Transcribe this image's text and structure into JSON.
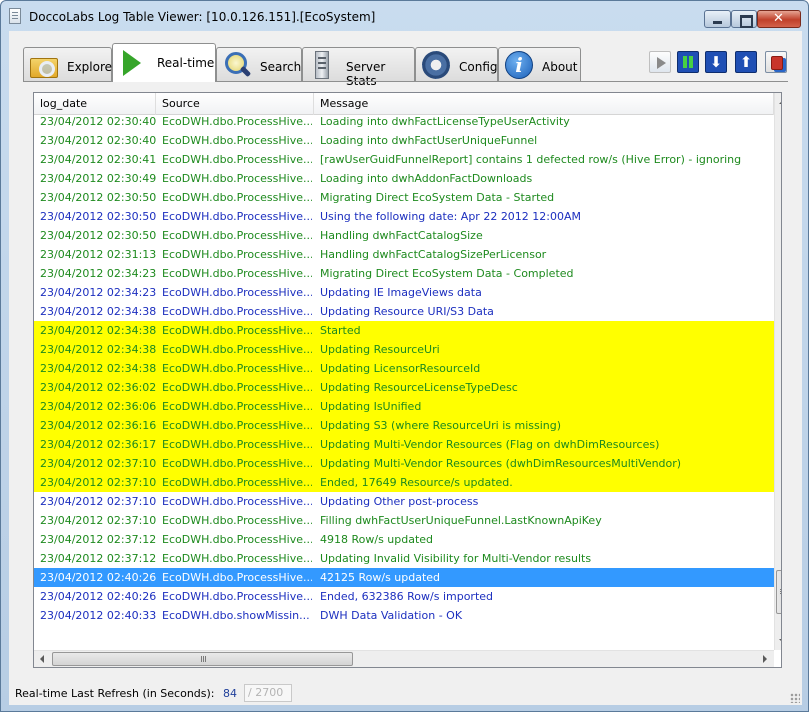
{
  "window": {
    "title": "DoccoLabs Log Table Viewer: [10.0.126.151].[EcoSystem]"
  },
  "tabs": [
    {
      "label": "Explore",
      "icon": "folder-search-icon"
    },
    {
      "label": "Real-time",
      "icon": "play-icon",
      "active": true
    },
    {
      "label": "Search",
      "icon": "magnifier-icon"
    },
    {
      "label": "Server Stats",
      "icon": "server-icon"
    },
    {
      "label": "Config",
      "icon": "gear-icon"
    },
    {
      "label": "About",
      "icon": "info-icon"
    }
  ],
  "toolbar": [
    "play-icon",
    "pause-icon",
    "scroll-down-icon",
    "scroll-up-icon",
    "export-icon"
  ],
  "grid": {
    "columns": [
      "log_date",
      "Source",
      "Message"
    ],
    "colors": {
      "green": "#1e8a1e",
      "blue": "#1c2fbf",
      "highlight": "#ffff00",
      "selection": "#3399ff"
    },
    "rows": [
      {
        "date": "23/04/2012 02:30:40",
        "source": "EcoDWH.dbo.ProcessHive...",
        "message": "Loading into dwhFactLicenseTypeUserActivity",
        "color": "green"
      },
      {
        "date": "23/04/2012 02:30:40",
        "source": "EcoDWH.dbo.ProcessHive...",
        "message": "Loading into dwhFactUserUniqueFunnel",
        "color": "green"
      },
      {
        "date": "23/04/2012 02:30:41",
        "source": "EcoDWH.dbo.ProcessHive...",
        "message": "[rawUserGuidFunnelReport] contains 1 defected row/s (Hive Error) - ignoring",
        "color": "green"
      },
      {
        "date": "23/04/2012 02:30:49",
        "source": "EcoDWH.dbo.ProcessHive...",
        "message": "Loading into dwhAddonFactDownloads",
        "color": "green"
      },
      {
        "date": "23/04/2012 02:30:50",
        "source": "EcoDWH.dbo.ProcessHive...",
        "message": "Migrating Direct EcoSystem Data - Started",
        "color": "green"
      },
      {
        "date": "23/04/2012 02:30:50",
        "source": "EcoDWH.dbo.ProcessHive...",
        "message": "Using the following date: Apr 22 2012 12:00AM",
        "color": "blue"
      },
      {
        "date": "23/04/2012 02:30:50",
        "source": "EcoDWH.dbo.ProcessHive...",
        "message": "Handling dwhFactCatalogSize",
        "color": "green"
      },
      {
        "date": "23/04/2012 02:31:13",
        "source": "EcoDWH.dbo.ProcessHive...",
        "message": "Handling dwhFactCatalogSizePerLicensor",
        "color": "green"
      },
      {
        "date": "23/04/2012 02:34:23",
        "source": "EcoDWH.dbo.ProcessHive...",
        "message": "Migrating Direct EcoSystem Data - Completed",
        "color": "green"
      },
      {
        "date": "23/04/2012 02:34:23",
        "source": "EcoDWH.dbo.ProcessHive...",
        "message": "Updating IE ImageViews data",
        "color": "blue"
      },
      {
        "date": "23/04/2012 02:34:38",
        "source": "EcoDWH.dbo.ProcessHive...",
        "message": "Updating Resource URI/S3 Data",
        "color": "blue"
      },
      {
        "date": "23/04/2012 02:34:38",
        "source": "EcoDWH.dbo.ProcessHive...",
        "message": "Started",
        "color": "green",
        "highlight": true
      },
      {
        "date": "23/04/2012 02:34:38",
        "source": "EcoDWH.dbo.ProcessHive...",
        "message": "Updating ResourceUri",
        "color": "green",
        "highlight": true
      },
      {
        "date": "23/04/2012 02:34:38",
        "source": "EcoDWH.dbo.ProcessHive...",
        "message": "Updating LicensorResourceId",
        "color": "green",
        "highlight": true
      },
      {
        "date": "23/04/2012 02:36:02",
        "source": "EcoDWH.dbo.ProcessHive...",
        "message": "Updating ResourceLicenseTypeDesc",
        "color": "green",
        "highlight": true
      },
      {
        "date": "23/04/2012 02:36:06",
        "source": "EcoDWH.dbo.ProcessHive...",
        "message": "Updating IsUnified",
        "color": "green",
        "highlight": true
      },
      {
        "date": "23/04/2012 02:36:16",
        "source": "EcoDWH.dbo.ProcessHive...",
        "message": "Updating S3 (where ResourceUri is missing)",
        "color": "green",
        "highlight": true
      },
      {
        "date": "23/04/2012 02:36:17",
        "source": "EcoDWH.dbo.ProcessHive...",
        "message": "Updating Multi-Vendor Resources (Flag on dwhDimResources)",
        "color": "green",
        "highlight": true
      },
      {
        "date": "23/04/2012 02:37:10",
        "source": "EcoDWH.dbo.ProcessHive...",
        "message": "Updating Multi-Vendor Resources (dwhDimResourcesMultiVendor)",
        "color": "green",
        "highlight": true
      },
      {
        "date": "23/04/2012 02:37:10",
        "source": "EcoDWH.dbo.ProcessHive...",
        "message": "Ended, 17649 Resource/s updated.",
        "color": "green",
        "highlight": true
      },
      {
        "date": "23/04/2012 02:37:10",
        "source": "EcoDWH.dbo.ProcessHive...",
        "message": "Updating Other post-process",
        "color": "blue"
      },
      {
        "date": "23/04/2012 02:37:10",
        "source": "EcoDWH.dbo.ProcessHive...",
        "message": "Filling dwhFactUserUniqueFunnel.LastKnownApiKey",
        "color": "green"
      },
      {
        "date": "23/04/2012 02:37:12",
        "source": "EcoDWH.dbo.ProcessHive...",
        "message": "4918 Row/s updated",
        "color": "green"
      },
      {
        "date": "23/04/2012 02:37:12",
        "source": "EcoDWH.dbo.ProcessHive...",
        "message": "Updating Invalid Visibility for Multi-Vendor results",
        "color": "green"
      },
      {
        "date": "23/04/2012 02:40:26",
        "source": "EcoDWH.dbo.ProcessHive...",
        "message": "42125 Row/s updated",
        "color": "green",
        "selected": true
      },
      {
        "date": "23/04/2012 02:40:26",
        "source": "EcoDWH.dbo.ProcessHive...",
        "message": "Ended, 632386 Row/s imported",
        "color": "blue"
      },
      {
        "date": "23/04/2012 02:40:33",
        "source": "EcoDWH.dbo.showMissin...",
        "message": "DWH Data Validation - OK",
        "color": "blue"
      }
    ]
  },
  "status": {
    "label": "Real-time Last Refresh (in Seconds):",
    "value": "84",
    "counter": "/ 2700"
  }
}
